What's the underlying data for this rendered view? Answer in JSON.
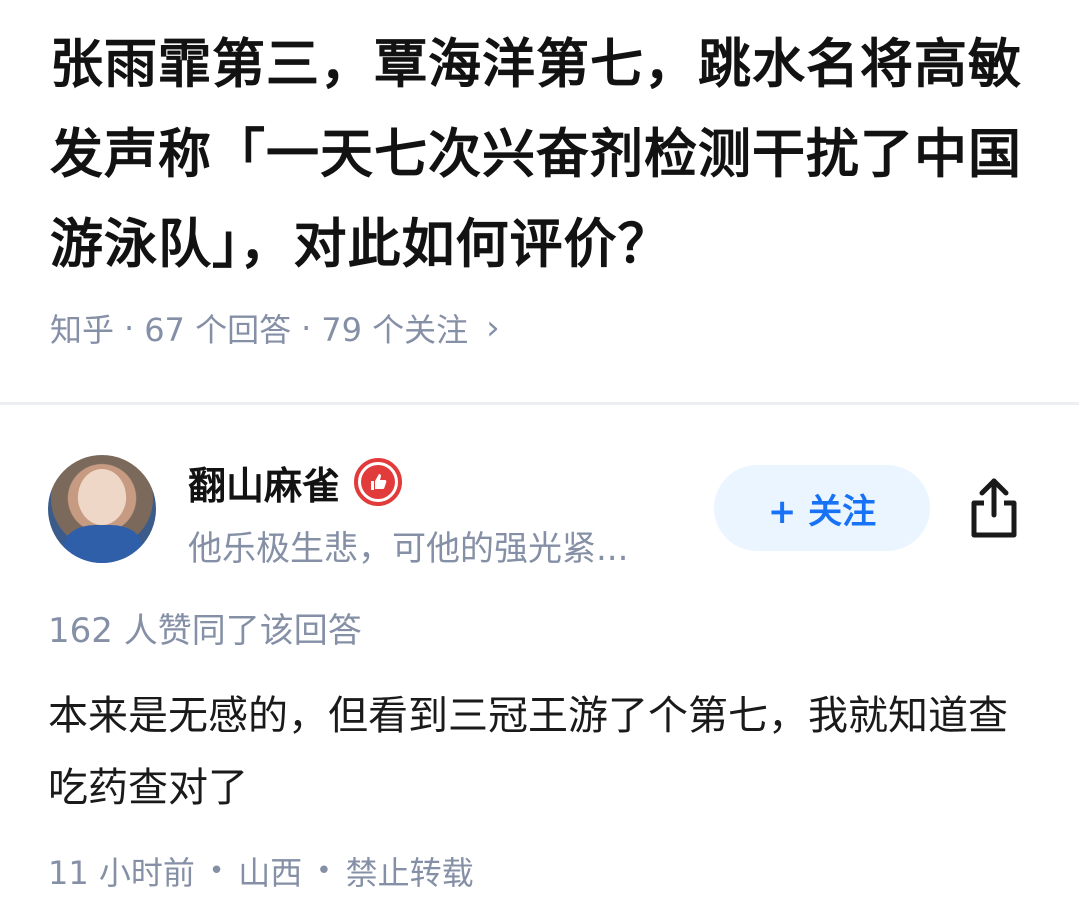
{
  "question": {
    "title": "张雨霏第三，覃海洋第七，跳水名将高敏发声称「一天七次兴奋剂检测干扰了中国游泳队」，对此如何评价？",
    "source": "知乎",
    "answers": "67 个回答",
    "followers": "79 个关注",
    "separator": "·"
  },
  "author": {
    "name": "翻山麻雀",
    "bio": "他乐极生悲，可他的强光紧...",
    "follow_label": "+ 关注",
    "badge_icon": "thumbs-up-badge-icon",
    "badge_color": "#e23b3b"
  },
  "answer": {
    "votes": "162 人赞同了该回答",
    "body": "本来是无感的，但看到三冠王游了个第七，我就知道查吃药查对了",
    "time": "11 小时前",
    "location": "山西",
    "repost": "禁止转载",
    "dot": "•"
  },
  "colors": {
    "accent": "#1772f6",
    "meta": "#8590a6",
    "follow_bg": "#ebf5ff"
  }
}
